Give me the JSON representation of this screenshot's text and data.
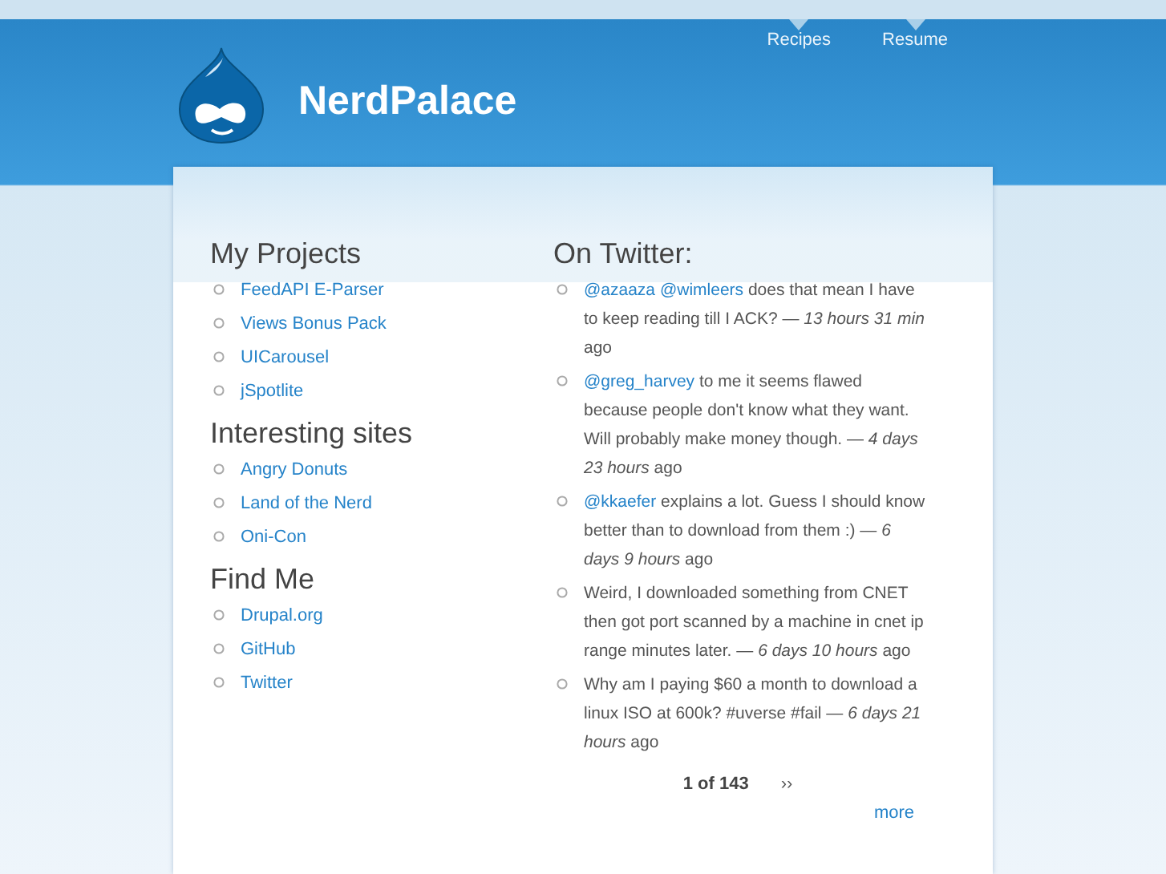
{
  "site": {
    "name": "NerdPalace"
  },
  "nav": [
    {
      "label": "Recipes"
    },
    {
      "label": "Resume"
    }
  ],
  "left_blocks": [
    {
      "title": "My Projects",
      "links": [
        "FeedAPI E-Parser",
        "Views Bonus Pack",
        "UICarousel",
        "jSpotlite"
      ]
    },
    {
      "title": "Interesting sites",
      "links": [
        "Angry Donuts",
        "Land of the Nerd",
        "Oni-Con"
      ]
    },
    {
      "title": "Find Me",
      "links": [
        "Drupal.org",
        "GitHub",
        "Twitter"
      ]
    }
  ],
  "twitter": {
    "title": "On Twitter:",
    "tweets": [
      {
        "mentions": [
          "@azaaza",
          "@wimleers"
        ],
        "text": "does that mean I have to keep reading till I ACK? — *13 hours 31 min* ago"
      },
      {
        "mentions": [
          "@greg_harvey"
        ],
        "text": "to me it seems flawed because people don't know what they want. Will probably make money though. — *4 days 23 hours* ago"
      },
      {
        "mentions": [
          "@kkaefer"
        ],
        "text": "explains a lot. Guess I should know better than to download from them :) — *6 days 9 hours* ago"
      },
      {
        "text": "Weird, I downloaded something from CNET then got port scanned by a machine in cnet ip range minutes later. — *6 days 10 hours* ago"
      },
      {
        "text": "Why am I paying $60 a month to download a linux ISO at 600k? #uverse #fail — *6 days 21 hours* ago"
      }
    ],
    "pager": {
      "current": "1 of 143",
      "next": "››"
    },
    "more": "more"
  }
}
